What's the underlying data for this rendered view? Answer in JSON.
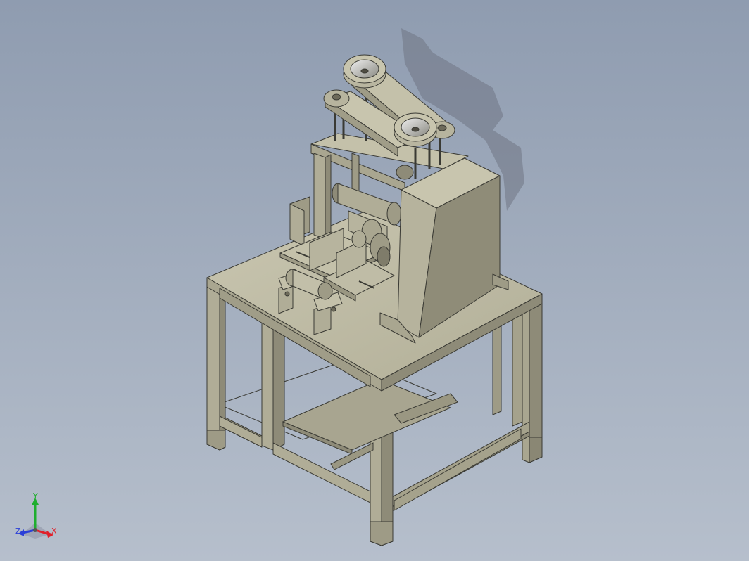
{
  "viewport": {
    "background_top": "#8f9cb0",
    "background_bottom": "#b6bfcc",
    "model_color": "#b3b09a",
    "edge_color": "#3a3a34"
  },
  "triad": {
    "x_label": "X",
    "y_label": "Y",
    "z_label": "Z",
    "x_color": "#e0202a",
    "y_color": "#1fae2f",
    "z_color": "#2a3fd8"
  }
}
